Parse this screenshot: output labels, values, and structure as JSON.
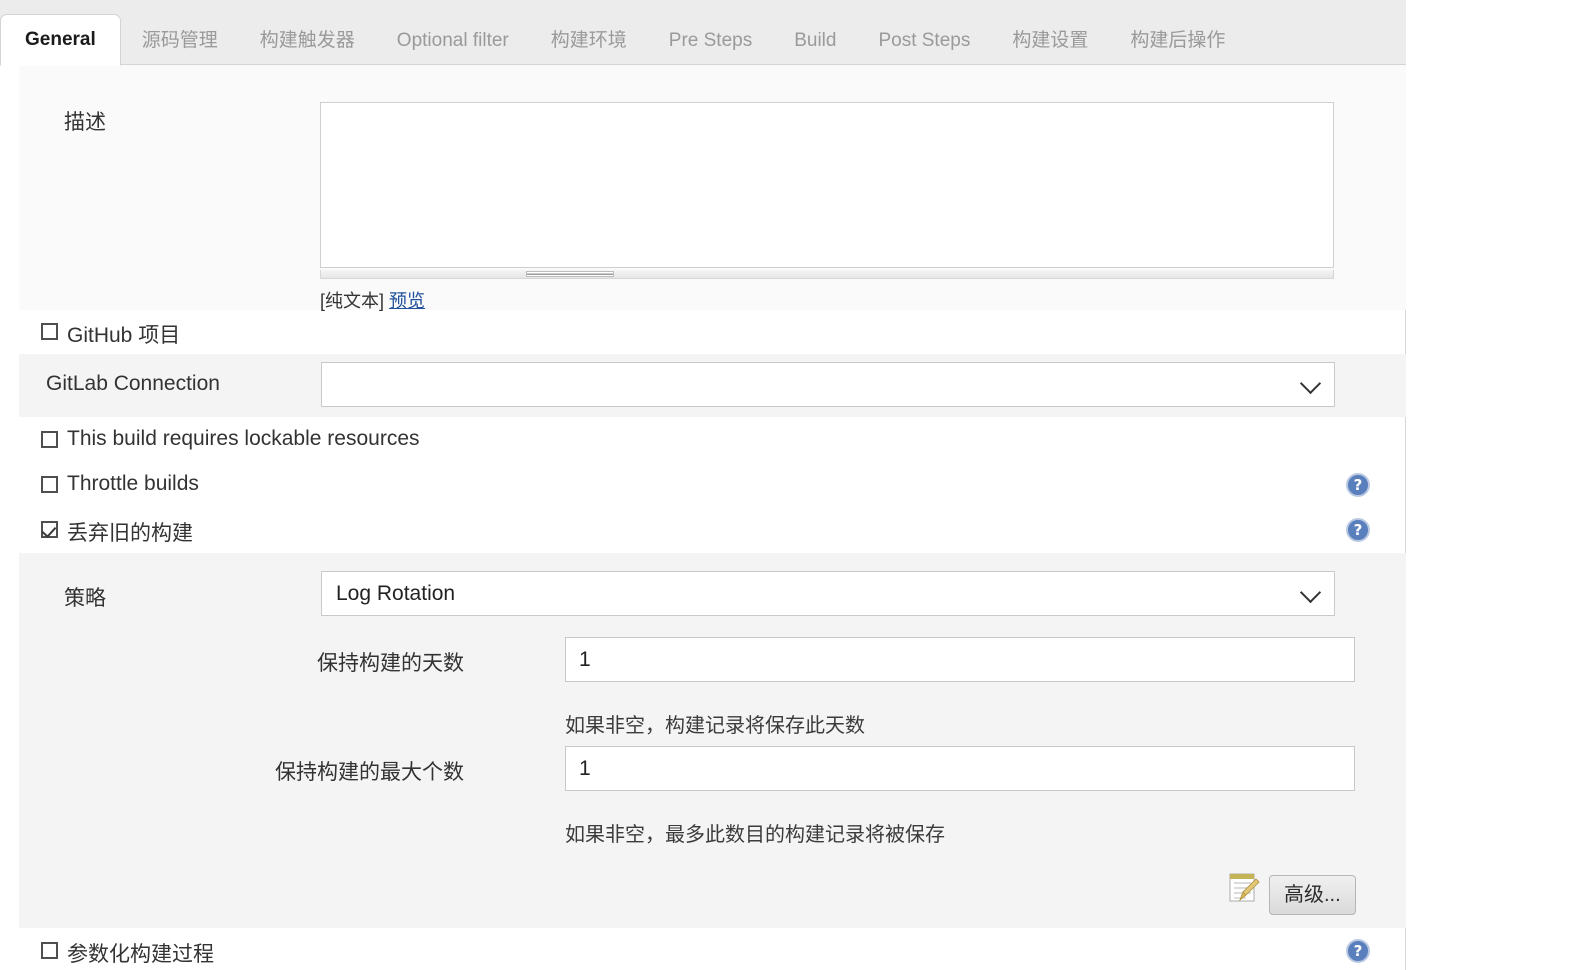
{
  "tabs": [
    {
      "label": "General",
      "active": true
    },
    {
      "label": "源码管理",
      "active": false
    },
    {
      "label": "构建触发器",
      "active": false
    },
    {
      "label": "Optional filter",
      "active": false
    },
    {
      "label": "构建环境",
      "active": false
    },
    {
      "label": "Pre Steps",
      "active": false
    },
    {
      "label": "Build",
      "active": false
    },
    {
      "label": "Post Steps",
      "active": false
    },
    {
      "label": "构建设置",
      "active": false
    },
    {
      "label": "构建后操作",
      "active": false
    }
  ],
  "description": {
    "label": "描述",
    "value": "",
    "markup_type": "[纯文本]",
    "preview_link": "预览"
  },
  "github_project": {
    "label": "GitHub 项目",
    "checked": false
  },
  "gitlab_connection": {
    "label": "GitLab Connection",
    "value": "",
    "chevron": "chevron-down-icon"
  },
  "lockable_resources": {
    "label": "This build requires lockable resources",
    "checked": false
  },
  "throttle_builds": {
    "label": "Throttle builds",
    "checked": false,
    "help": "?"
  },
  "discard_old_builds": {
    "label": "丢弃旧的构建",
    "checked": true,
    "help": "?"
  },
  "strategy": {
    "label": "策略",
    "value": "Log Rotation"
  },
  "days_to_keep": {
    "label": "保持构建的天数",
    "value": "1",
    "hint": "如果非空，构建记录将保存此天数"
  },
  "max_builds_to_keep": {
    "label": "保持构建的最大个数",
    "value": "1",
    "hint": "如果非空，最多此数目的构建记录将被保存"
  },
  "advanced": {
    "label": "高级...",
    "icon": "notepad-pencil-icon"
  },
  "parameterized_build": {
    "label": "参数化构建过程",
    "checked": false,
    "help": "?"
  },
  "colors": {
    "accent_link": "#21519c",
    "help_blue": "#5a7fbd",
    "tab_bar_bg": "#ececec",
    "section_bg": "#f4f4f4"
  }
}
